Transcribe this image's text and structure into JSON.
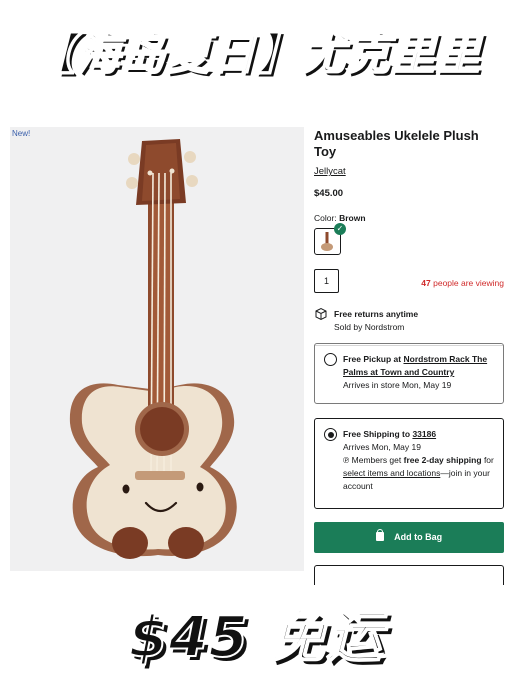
{
  "banner": {
    "top": "【海岛夏日】尤克里里",
    "bottom": "$45 免运"
  },
  "product": {
    "badge": "New!",
    "title": "Amuseables Ukelele Plush Toy",
    "brand": "Jellycat",
    "price": "$45.00",
    "color_label": "Color:",
    "color_value": "Brown",
    "quantity": "1",
    "viewing_count": "47",
    "viewing_text": "people are viewing"
  },
  "returns": {
    "title": "Free returns anytime",
    "sold_by": "Sold by Nordstrom"
  },
  "pickup": {
    "prefix": "Free Pickup at",
    "store": "Nordstrom Rack The Palms at Town and Country",
    "arrival": "Arrives in store Mon, May 19"
  },
  "shipping": {
    "prefix": "Free Shipping to",
    "zip": "33186",
    "arrival": "Arrives Mon, May 19",
    "members_prefix": "Members get",
    "members_bold": "free 2-day shipping",
    "members_for": "for",
    "members_link": "select items and locations",
    "members_suffix": "—join in your account"
  },
  "actions": {
    "add_to_bag": "Add to Bag"
  },
  "colors": {
    "accent": "#1b7d58",
    "urgency": "#d02b2b",
    "badge": "#385eaa"
  }
}
